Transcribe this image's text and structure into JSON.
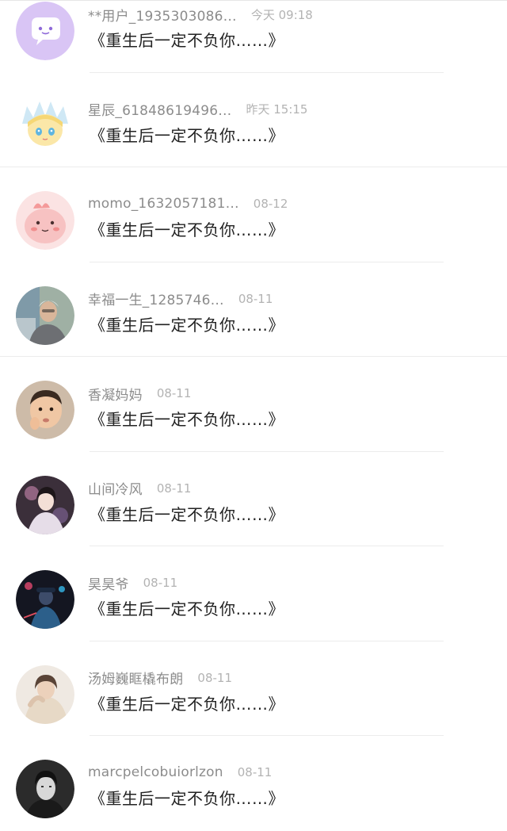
{
  "messages": [
    {
      "name": "**用户_1935303086…",
      "time": "今天 09:18",
      "text": "《重生后一定不负你……》",
      "avatar": "purple-chat-bubble-avatar"
    },
    {
      "name": "星辰_61848619496…",
      "time": "昨天 15:15",
      "text": "《重生后一定不负你……》",
      "avatar": "anime-character-avatar"
    },
    {
      "name": "momo_1632057181…",
      "time": "08-12",
      "text": "《重生后一定不负你……》",
      "avatar": "pink-cartoon-avatar"
    },
    {
      "name": "幸福一生_1285746…",
      "time": "08-11",
      "text": "《重生后一定不负你……》",
      "avatar": "elderly-man-photo-avatar"
    },
    {
      "name": "香凝妈妈",
      "time": "08-11",
      "text": "《重生后一定不负你……》",
      "avatar": "child-photo-avatar"
    },
    {
      "name": "山间冷风",
      "time": "08-11",
      "text": "《重生后一定不负你……》",
      "avatar": "woman-illustration-avatar"
    },
    {
      "name": "昊昊爷",
      "time": "08-11",
      "text": "《重生后一定不负你……》",
      "avatar": "neon-figure-avatar"
    },
    {
      "name": "汤姆巍眶橇布朗",
      "time": "08-11",
      "text": "《重生后一定不负你……》",
      "avatar": "person-photo-avatar"
    },
    {
      "name": "marcpelcobuiorlzon",
      "time": "08-11",
      "text": "《重生后一定不负你……》",
      "avatar": "man-bw-photo-avatar"
    }
  ]
}
